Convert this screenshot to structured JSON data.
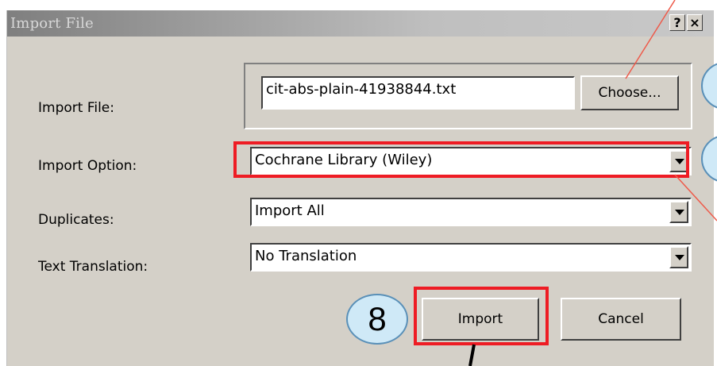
{
  "dialog": {
    "title": "Import File",
    "help_button": "?",
    "close_button": "×"
  },
  "fields": {
    "import_file_label": "Import File:",
    "import_file_value": "cit-abs-plain-41938844.txt",
    "choose_button": "Choose...",
    "import_option_label": "Import Option:",
    "import_option_value": "Cochrane Library (Wiley)",
    "duplicates_label": "Duplicates:",
    "duplicates_value": "Import All",
    "text_translation_label": "Text Translation:",
    "text_translation_value": "No Translation"
  },
  "actions": {
    "import_button": "Import",
    "cancel_button": "Cancel"
  },
  "annotations": {
    "step_number": "8",
    "highlight_color": "#ee1c24",
    "bubble_color": "#cfe9f7"
  }
}
